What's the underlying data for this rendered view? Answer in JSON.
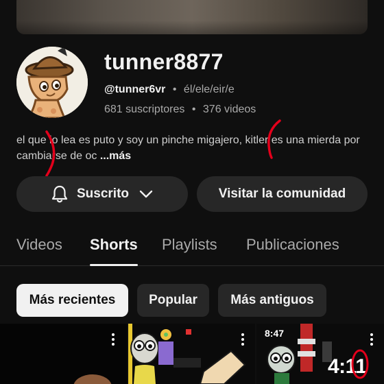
{
  "channel": {
    "name": "tunner8877",
    "handle": "@tunner6vr",
    "pronouns": "él/ele/eir/e",
    "separator": "•",
    "subscribers": "681 suscriptores",
    "videos": "376 videos",
    "description": "el que lo lea es puto y soy un pinche migajero, kitler es una mierda por cambiarse de oc",
    "more_label": "...más"
  },
  "actions": {
    "subscribed_label": "Suscrito",
    "community_label": "Visitar la comunidad"
  },
  "tabs": [
    {
      "label": "Videos",
      "active": false
    },
    {
      "label": "Shorts",
      "active": true
    },
    {
      "label": "Playlists",
      "active": false
    },
    {
      "label": "Publicaciones",
      "active": false
    }
  ],
  "filters": [
    {
      "label": "Más recientes",
      "selected": true
    },
    {
      "label": "Popular",
      "selected": false
    },
    {
      "label": "Más antiguos",
      "selected": false
    }
  ],
  "shorts": [
    {
      "overlay_text": ""
    },
    {
      "overlay_text": ""
    },
    {
      "timestamp": "8:47",
      "overlay_text": "4:11"
    }
  ],
  "icons": {
    "bell": "bell-icon",
    "chevron": "chevron-down-icon",
    "more": "more-vert-icon"
  },
  "colors": {
    "background": "#0f0f0f",
    "button": "#272727",
    "text": "#f1f1f1",
    "secondary_text": "#aaaaaa",
    "annotation_red": "#e3001b"
  }
}
